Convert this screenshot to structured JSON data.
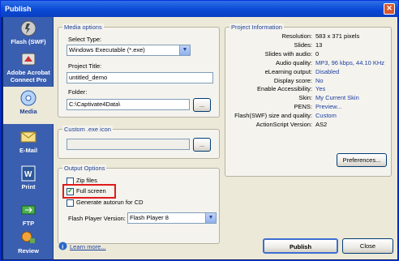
{
  "window": {
    "title": "Publish",
    "close_label": "✕"
  },
  "sidebar": {
    "items": [
      {
        "label": "Flash (SWF)",
        "icon": "flash-icon"
      },
      {
        "label": "Adobe Acrobat Connect Pro",
        "icon": "connect-icon"
      },
      {
        "label": "Media",
        "icon": "media-icon",
        "active": true
      },
      {
        "label": "E-Mail",
        "icon": "email-icon"
      },
      {
        "label": "Print",
        "icon": "print-icon"
      },
      {
        "label": "FTP",
        "icon": "ftp-icon"
      },
      {
        "label": "Review",
        "icon": "review-icon"
      }
    ]
  },
  "media_options": {
    "legend": "Media options",
    "select_type_label": "Select Type:",
    "select_type_value": "Windows Executable (*.exe)",
    "project_title_label": "Project Title:",
    "project_title_value": "untitled_demo",
    "folder_label": "Folder:",
    "folder_value": "C:\\Captivate4Data\\",
    "browse_label": "..."
  },
  "custom_icon": {
    "legend": "Custom .exe icon",
    "value": "",
    "browse_label": "..."
  },
  "output_options": {
    "legend": "Output Options",
    "zip_label": "Zip files",
    "zip_checked": false,
    "fullscreen_label": "Full screen",
    "fullscreen_checked": true,
    "autorun_label": "Generate autorun for CD",
    "autorun_checked": false,
    "flash_version_label": "Flash Player Version:",
    "flash_version_value": "Flash Player 8"
  },
  "project_info": {
    "legend": "Project Information",
    "rows": [
      {
        "label": "Resolution:",
        "value": "583 x 371 pixels",
        "link": false
      },
      {
        "label": "Slides:",
        "value": "13",
        "link": false
      },
      {
        "label": "Slides with audio:",
        "value": "0",
        "link": false
      },
      {
        "label": "Audio quality:",
        "value": "MP3, 96 kbps, 44.10 KHz",
        "link": true
      },
      {
        "label": "eLearning output:",
        "value": "Disabled",
        "link": true
      },
      {
        "label": "Display score:",
        "value": "No",
        "link": true
      },
      {
        "label": "Enable Accessibility:",
        "value": "Yes",
        "link": true
      },
      {
        "label": "Skin:",
        "value": "My Current Skin",
        "link": true
      },
      {
        "label": "PENS:",
        "value": "Preview...",
        "link": true
      },
      {
        "label": "Flash(SWF) size and quality:",
        "value": "Custom",
        "link": true
      },
      {
        "label": "ActionScript Version:",
        "value": "AS2",
        "link": false
      }
    ],
    "preferences_label": "Preferences..."
  },
  "footer": {
    "learn_more": "Learn more...",
    "publish_label": "Publish",
    "close_label": "Close"
  },
  "colors": {
    "accent": "#1c3f95",
    "highlight": "#e01b1b",
    "titlebar": "#0a4ad6"
  }
}
